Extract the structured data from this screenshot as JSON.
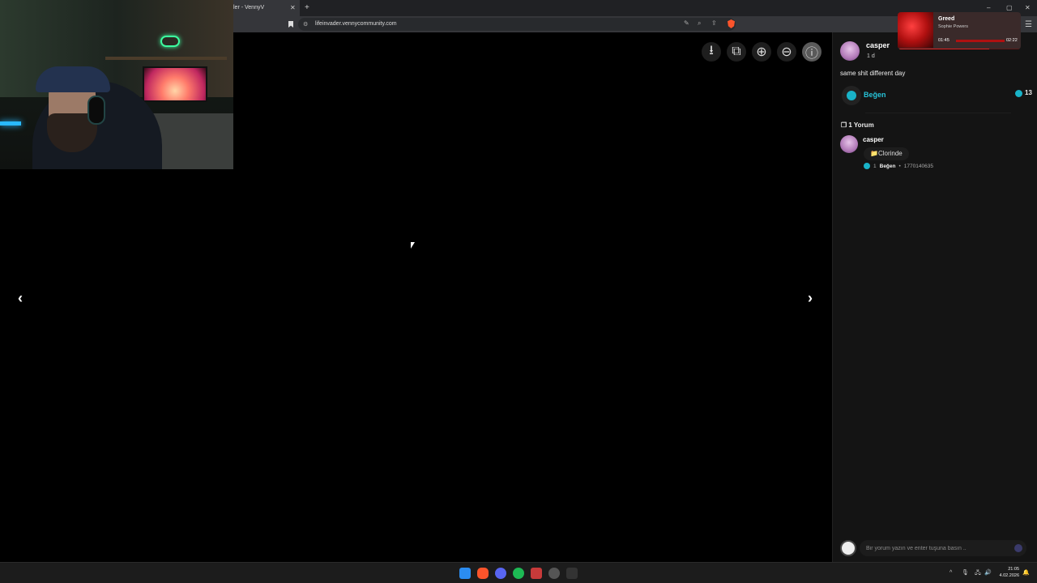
{
  "browser": {
    "tab_title": "ler - VennyV",
    "tab_close": "✕",
    "new_tab": "+",
    "url": "lifeinvader.vennycommunity.com",
    "window_controls": [
      "–",
      "▢",
      "✕"
    ]
  },
  "viewer": {
    "tools": [
      {
        "name": "download-icon",
        "glyph": "⭳"
      },
      {
        "name": "open-external-icon",
        "glyph": "⧉"
      },
      {
        "name": "zoom-in-icon",
        "glyph": "⊕"
      },
      {
        "name": "zoom-out-icon",
        "glyph": "⊖"
      },
      {
        "name": "info-icon",
        "glyph": "ⓘ"
      }
    ],
    "prev_arrow": "‹",
    "next_arrow": "›"
  },
  "post": {
    "author": "casper",
    "time": "1 d",
    "text": "same shit different day",
    "like_label": "Beğen",
    "like_count": "13"
  },
  "comments": {
    "header": "1 Yorum",
    "items": [
      {
        "author": "casper",
        "text": "📁Clorinde",
        "likes": "1",
        "like_label": "Beğen",
        "separator": "•",
        "timestamp": "1770140635"
      }
    ],
    "input_placeholder": "Bir yorum yazın ve enter tuşuna basın .."
  },
  "music": {
    "title": "Greed",
    "artist": "Sophie Powers",
    "elapsed": "01:45",
    "total": "02:22",
    "progress": 0.74
  },
  "taskbar": {
    "clock_time": "21:05",
    "clock_date": "4.02.2026",
    "tray_chevron": "^"
  },
  "colors": {
    "accent": "#19b3c8",
    "like_text": "#27c3d8",
    "music_bar": "#e02020"
  }
}
